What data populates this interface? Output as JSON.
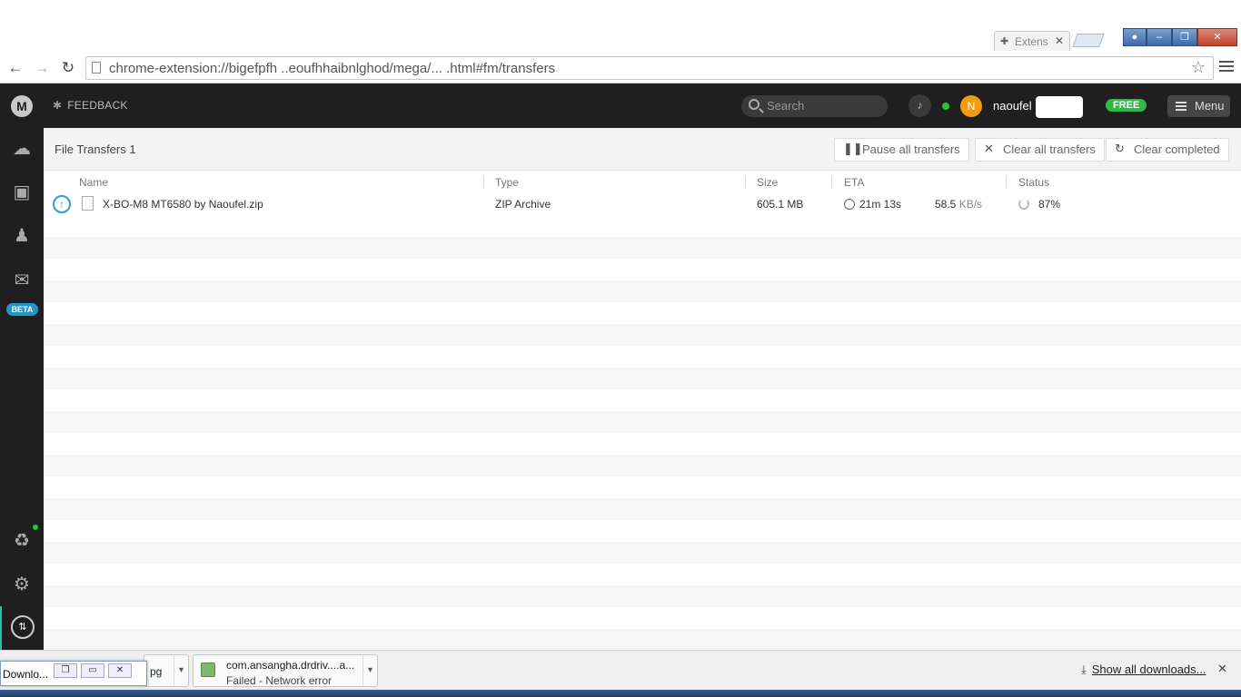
{
  "browser": {
    "tab": {
      "title": "Extens"
    },
    "url": "chrome-extension://bigefpfh     ..eoufhhaibnlghod/mega/... .html#fm/transfers"
  },
  "topbar": {
    "feedback_label": "FEEDBACK",
    "search_placeholder": "Search",
    "avatar_initial": "N",
    "username": "naoufel",
    "plan_badge": "FREE",
    "menu_label": "Menu"
  },
  "sidebar": {
    "beta_label": "BETA"
  },
  "transfers": {
    "title": "File Transfers 1",
    "buttons": {
      "pause_all": "Pause all transfers",
      "clear_all": "Clear all transfers",
      "clear_completed": "Clear completed"
    },
    "columns": {
      "name": "Name",
      "type": "Type",
      "size": "Size",
      "eta": "ETA",
      "status": "Status"
    },
    "items": [
      {
        "name": "X-BO-M8 MT6580 by Naoufel.zip",
        "type": "ZIP Archive",
        "size": "605.1 MB",
        "eta": "21m  13s",
        "speed": "58.5",
        "speed_unit": "KB/s",
        "status": "87%"
      }
    ]
  },
  "downloads_shelf": {
    "item_partial": "pg",
    "item_name": "com.ansangha.drdriv....a...",
    "item_status": "Failed - Network error",
    "show_all": "Show all downloads...",
    "popup_title": "Downlo..."
  }
}
